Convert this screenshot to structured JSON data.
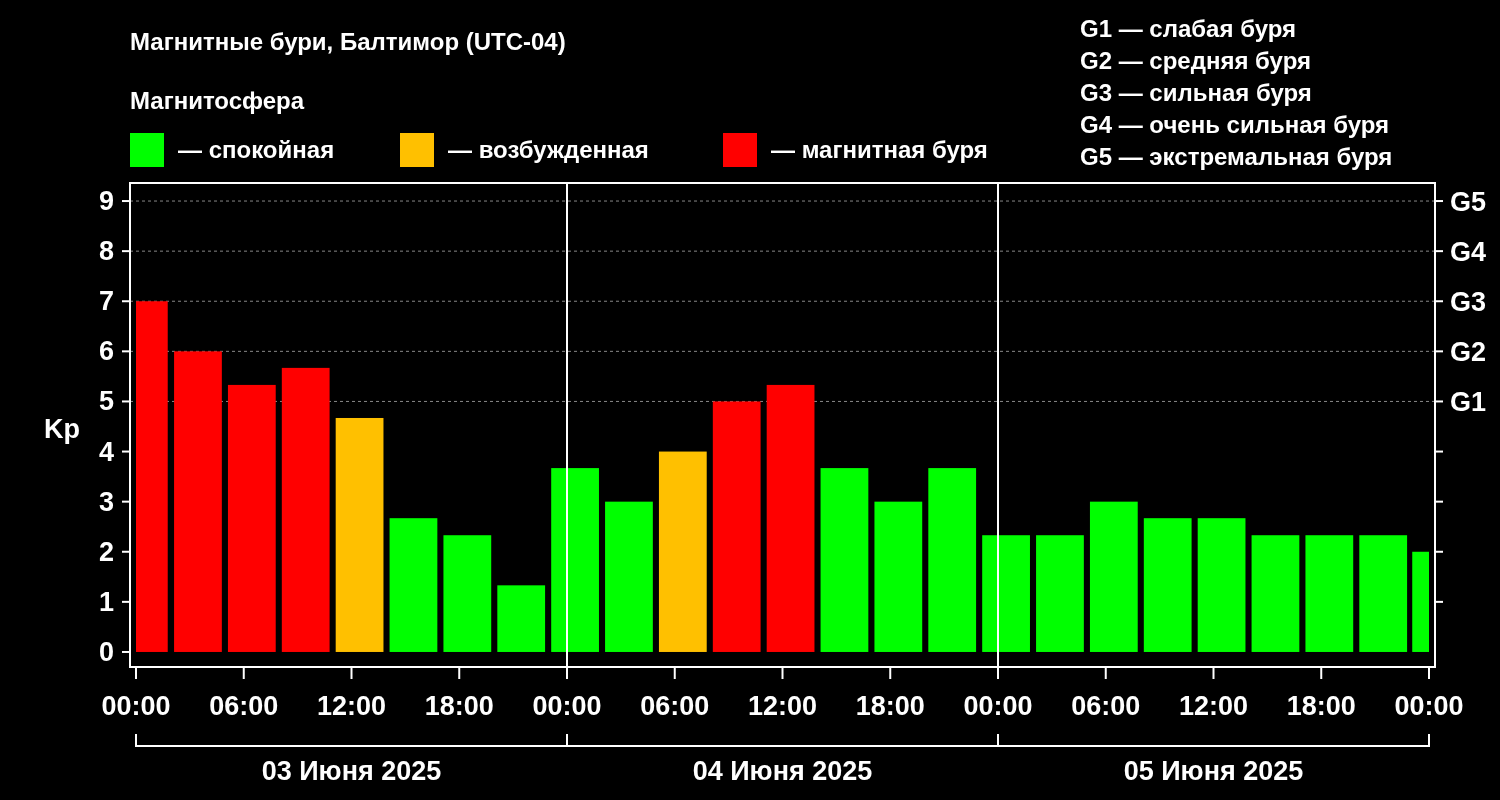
{
  "title": "Магнитные бури, Балтимор (UTC-04)",
  "legend": {
    "title": "Магнитосфера"
  },
  "storm_scale": [
    "G1 — слабая буря",
    "G2 — средняя буря",
    "G3 — сильная буря",
    "G4 — очень сильная буря",
    "G5 — экстремальная буря"
  ],
  "chart": {
    "chart_data": {
      "type": "bar",
      "ylabel": "Kp",
      "stacked": true,
      "grid": true,
      "legend": "top",
      "x": [
        "2025-06-03T00:53",
        "2025-06-03T03:27",
        "2025-06-03T06:27",
        "2025-06-03T09:27",
        "2025-06-03T12:27",
        "2025-06-03T15:27",
        "2025-06-03T18:27",
        "2025-06-03T21:27",
        "2025-06-04T00:27",
        "2025-06-04T03:27",
        "2025-06-04T06:27",
        "2025-06-04T09:27",
        "2025-06-04T12:27",
        "2025-06-04T15:27",
        "2025-06-04T18:27",
        "2025-06-04T21:27",
        "2025-06-05T00:27",
        "2025-06-05T03:27",
        "2025-06-05T06:27",
        "2025-06-05T09:27",
        "2025-06-05T12:27",
        "2025-06-05T15:27",
        "2025-06-05T18:27",
        "2025-06-05T21:27",
        "2025-06-05T23:32"
      ],
      "series": [
        {
          "name": "— спокойная",
          "color": "#00ff00",
          "values": [
            null,
            null,
            null,
            null,
            null,
            2.67,
            2.33,
            1.33,
            3.67,
            3,
            null,
            null,
            null,
            3.67,
            3,
            3.67,
            2.33,
            2.33,
            3,
            2.67,
            2.67,
            2.33,
            2.33,
            2.33,
            2
          ]
        },
        {
          "name": "— возбужденная",
          "color": "#ffc000",
          "values": [
            null,
            null,
            null,
            null,
            4.67,
            null,
            null,
            null,
            null,
            null,
            4,
            null,
            null,
            null,
            null,
            null,
            null,
            null,
            null,
            null,
            null,
            null,
            null,
            null,
            null
          ]
        },
        {
          "name": "— магнитная буря",
          "color": "#ff0000",
          "values": [
            7,
            6,
            5.33,
            5.67,
            null,
            null,
            null,
            null,
            null,
            null,
            null,
            5,
            5.33,
            null,
            null,
            null,
            null,
            null,
            null,
            null,
            null,
            null,
            null,
            null,
            null
          ]
        }
      ],
      "xlim": [
        "2025-06-03T00:00",
        "2025-06-06T00:00"
      ],
      "ylim": [
        -0.3,
        9.36
      ],
      "xticks": [
        {
          "value": "2025-06-03T00:00",
          "label": "00:00"
        },
        {
          "value": "2025-06-03T06:00",
          "label": "06:00"
        },
        {
          "value": "2025-06-03T12:00",
          "label": "12:00"
        },
        {
          "value": "2025-06-03T18:00",
          "label": "18:00"
        },
        {
          "value": "2025-06-04T00:00",
          "label": "00:00"
        },
        {
          "value": "2025-06-04T06:00",
          "label": "06:00"
        },
        {
          "value": "2025-06-04T12:00",
          "label": "12:00"
        },
        {
          "value": "2025-06-04T18:00",
          "label": "18:00"
        },
        {
          "value": "2025-06-05T00:00",
          "label": "00:00"
        },
        {
          "value": "2025-06-05T06:00",
          "label": "06:00"
        },
        {
          "value": "2025-06-05T12:00",
          "label": "12:00"
        },
        {
          "value": "2025-06-05T18:00",
          "label": "18:00"
        },
        {
          "value": "2025-06-06T00:00",
          "label": "00:00"
        }
      ],
      "yticks": [
        0,
        1,
        2,
        3,
        4,
        5,
        6,
        7,
        8,
        9
      ]
    },
    "storm_levels": [
      "G5",
      "G4",
      "G3",
      "G2",
      "G1"
    ],
    "dates": [
      "03 Июня 2025",
      "04 Июня 2025",
      "05 Июня 2025"
    ]
  }
}
